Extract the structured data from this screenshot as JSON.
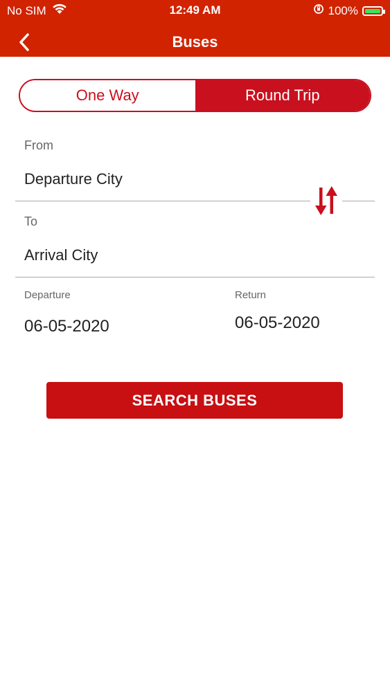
{
  "status_bar": {
    "carrier": "No SIM",
    "time": "12:49 AM",
    "battery_percent": "100%"
  },
  "header": {
    "title": "Buses",
    "back_icon": "chevron-left-icon"
  },
  "trip_type": {
    "options": [
      "One Way",
      "Round Trip"
    ],
    "selected": "Round Trip"
  },
  "from": {
    "label": "From",
    "value": "Departure City"
  },
  "to": {
    "label": "To",
    "value": "Arrival City"
  },
  "dates": {
    "departure_label": "Departure",
    "departure_value": "06-05-2020",
    "return_label": "Return",
    "return_value": "06-05-2020"
  },
  "actions": {
    "search_label": "SEARCH BUSES"
  },
  "colors": {
    "primary": "#c8101e",
    "topbar": "#d12300"
  }
}
